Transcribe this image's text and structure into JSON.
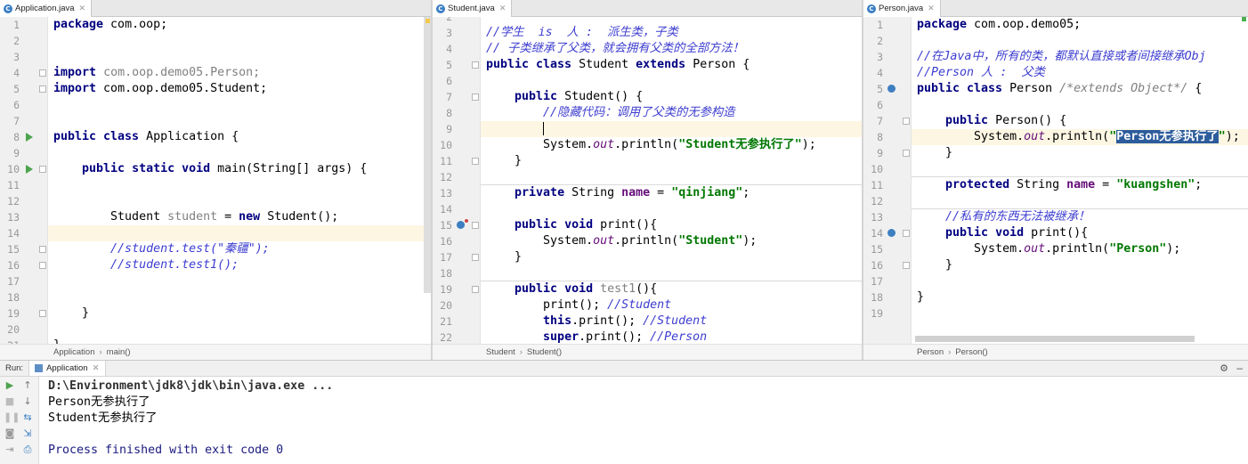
{
  "panes": {
    "application": {
      "tab_title": "Application.java",
      "breadcrumb": [
        "Application",
        "main()"
      ],
      "lines": [
        {
          "n": "1",
          "html": "<span class=\"kw\">package</span> com.oop;"
        },
        {
          "n": "2",
          "html": ""
        },
        {
          "n": "3",
          "html": ""
        },
        {
          "n": "4",
          "html": "<span class=\"kw\">import</span> <span class=\"gr\">com.oop.demo05.Person;</span>"
        },
        {
          "n": "5",
          "html": "<span class=\"kw\">import</span> com.oop.demo05.Student;"
        },
        {
          "n": "6",
          "html": ""
        },
        {
          "n": "7",
          "html": ""
        },
        {
          "n": "8",
          "html": "<span class=\"kw\">public class</span> Application {"
        },
        {
          "n": "9",
          "html": ""
        },
        {
          "n": "10",
          "html": "    <span class=\"kw\">public static void</span> main(String[] args) {"
        },
        {
          "n": "11",
          "html": ""
        },
        {
          "n": "12",
          "html": ""
        },
        {
          "n": "13",
          "html": "        Student <span class=\"gr\">student</span> = <span class=\"kw\">new</span> Student();"
        },
        {
          "n": "14",
          "html": ""
        },
        {
          "n": "15",
          "html": "        <span class=\"cm\">//student.test(\"秦疆\");</span>"
        },
        {
          "n": "16",
          "html": "        <span class=\"cm\">//student.test1();</span>"
        },
        {
          "n": "17",
          "html": ""
        },
        {
          "n": "18",
          "html": ""
        },
        {
          "n": "19",
          "html": "    }"
        },
        {
          "n": "20",
          "html": ""
        },
        {
          "n": "21",
          "html": "}"
        }
      ]
    },
    "student": {
      "tab_title": "Student.java",
      "breadcrumb": [
        "Student",
        "Student()"
      ],
      "lines": [
        {
          "n": "2",
          "html": ""
        },
        {
          "n": "3",
          "html": "<span class=\"cm\">//学生  is  人 :  派生类，子类</span>"
        },
        {
          "n": "4",
          "html": "<span class=\"cm\">// 子类继承了父类，就会拥有父类的全部方法！</span>"
        },
        {
          "n": "5",
          "html": "<span class=\"kw\">public class</span> Student <span class=\"kw\">extends</span> Person {"
        },
        {
          "n": "6",
          "html": ""
        },
        {
          "n": "7",
          "html": "    <span class=\"kw\">public</span> Student() {"
        },
        {
          "n": "8",
          "html": "        <span class=\"cm\">//隐藏代码：调用了父类的无参构造</span>"
        },
        {
          "n": "9",
          "html": "        <span class=\"caret\"></span>"
        },
        {
          "n": "10",
          "html": "        System.<span class=\"ifld\">out</span>.println(<span class=\"str\">\"Student无参执行了\"</span>);"
        },
        {
          "n": "11",
          "html": "    }"
        },
        {
          "n": "12",
          "html": ""
        },
        {
          "n": "13",
          "html": "    <span class=\"kw\">private</span> String <span class=\"fld\">name</span> = <span class=\"str\">\"qinjiang\"</span>;"
        },
        {
          "n": "14",
          "html": ""
        },
        {
          "n": "15",
          "html": "    <span class=\"kw\">public void</span> print(){"
        },
        {
          "n": "16",
          "html": "        System.<span class=\"ifld\">out</span>.println(<span class=\"str\">\"Student\"</span>);"
        },
        {
          "n": "17",
          "html": "    }"
        },
        {
          "n": "18",
          "html": ""
        },
        {
          "n": "19",
          "html": "    <span class=\"kw\">public void</span> <span class=\"gr\">test1</span>(){"
        },
        {
          "n": "20",
          "html": "        print(); <span class=\"cm\">//Student</span>"
        },
        {
          "n": "21",
          "html": "        <span class=\"kw\">this</span>.print(); <span class=\"cm\">//Student</span>"
        },
        {
          "n": "22",
          "html": "        <span class=\"kw\">super</span>.print(); <span class=\"cm\">//Person</span>"
        }
      ]
    },
    "person": {
      "tab_title": "Person.java",
      "breadcrumb": [
        "Person",
        "Person()"
      ],
      "lines": [
        {
          "n": "1",
          "html": "<span class=\"kw\">package</span> com.oop.demo05;"
        },
        {
          "n": "2",
          "html": ""
        },
        {
          "n": "3",
          "html": "<span class=\"cm\">//在Java中，所有的类，都默认直接或者间接继承Obj</span>"
        },
        {
          "n": "4",
          "html": "<span class=\"cm\">//Person 人 :  父类</span>"
        },
        {
          "n": "5",
          "html": "<span class=\"kw\">public class</span> Person <span class=\"gr ital\">/*extends Object*/</span> {"
        },
        {
          "n": "6",
          "html": ""
        },
        {
          "n": "7",
          "html": "    <span class=\"kw\">public</span> Person() {"
        },
        {
          "n": "8",
          "html": "        System.<span class=\"ifld\">out</span>.println(<span class=\"str\">\"<span style=\"background:#2d5c9c;color:#fff;\">Person无参执行了</span>\"</span>);"
        },
        {
          "n": "9",
          "html": "    }"
        },
        {
          "n": "10",
          "html": ""
        },
        {
          "n": "11",
          "html": "    <span class=\"kw\">protected</span> String <span class=\"fld\">name</span> = <span class=\"str\">\"kuangshen\"</span>;"
        },
        {
          "n": "12",
          "html": ""
        },
        {
          "n": "13",
          "html": "    <span class=\"cm\">//私有的东西无法被继承！</span>"
        },
        {
          "n": "14",
          "html": "    <span class=\"kw\">public void</span> print(){"
        },
        {
          "n": "15",
          "html": "        System.<span class=\"ifld\">out</span>.println(<span class=\"str\">\"Person\"</span>);"
        },
        {
          "n": "16",
          "html": "    }"
        },
        {
          "n": "17",
          "html": ""
        },
        {
          "n": "18",
          "html": "}"
        },
        {
          "n": "19",
          "html": ""
        }
      ]
    }
  },
  "run": {
    "label": "Run:",
    "tab_title": "Application",
    "console": [
      "D:\\Environment\\jdk8\\jdk\\bin\\java.exe ...",
      "Person无参执行了",
      "Student无参执行了",
      "",
      "Process finished with exit code 0"
    ]
  }
}
